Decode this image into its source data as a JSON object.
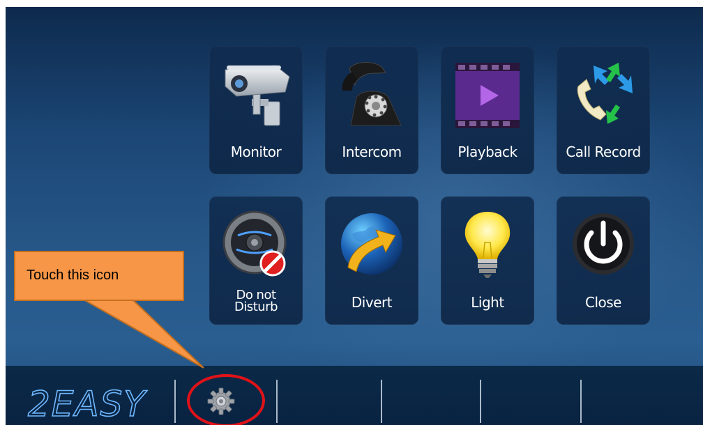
{
  "tiles": [
    {
      "label": "Monitor",
      "icon": "cctv-camera-icon"
    },
    {
      "label": "Intercom",
      "icon": "rotary-phone-icon"
    },
    {
      "label": "Playback",
      "icon": "video-play-icon"
    },
    {
      "label": "Call Record",
      "icon": "call-record-icon"
    },
    {
      "label": "Do not\nDisturb",
      "icon": "speaker-mute-icon"
    },
    {
      "label": "Divert",
      "icon": "globe-divert-icon"
    },
    {
      "label": "Light",
      "icon": "light-bulb-icon"
    },
    {
      "label": "Close",
      "icon": "power-icon"
    }
  ],
  "bottom_bar": {
    "logo_text": "2EASY",
    "settings_icon": "gear-icon"
  },
  "callout": {
    "text": "Touch this icon"
  },
  "colors": {
    "callout": "#f79646",
    "highlight_ring": "#e01218",
    "tile_bg": "#102c50"
  }
}
